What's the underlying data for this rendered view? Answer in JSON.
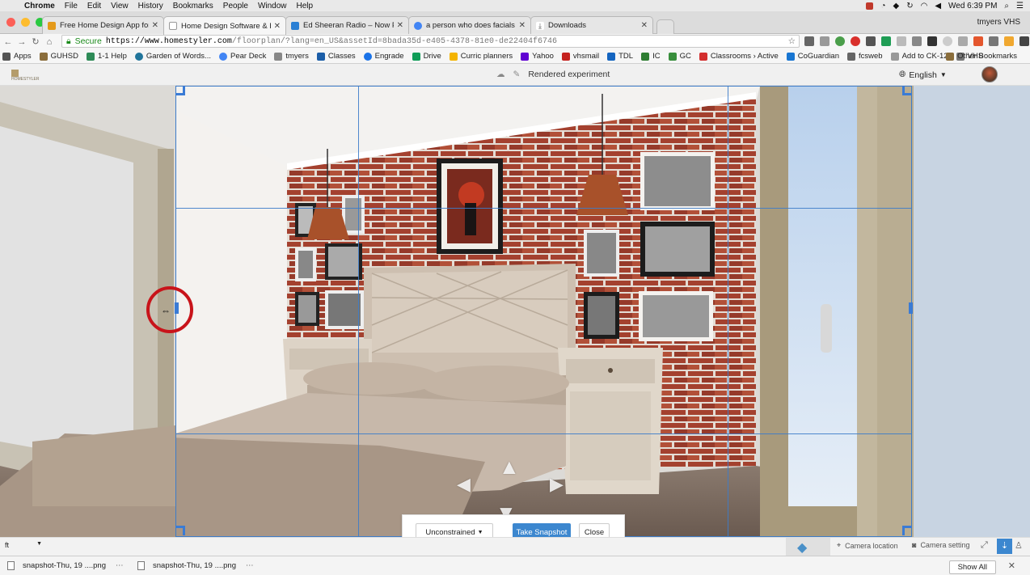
{
  "menubar": {
    "app": "Chrome",
    "items": [
      "File",
      "Edit",
      "View",
      "History",
      "Bookmarks",
      "People",
      "Window",
      "Help"
    ],
    "clock": "Wed 6:39 PM"
  },
  "tabs": [
    {
      "title": "Free Home Design App for In",
      "favicon": "#e49a1a"
    },
    {
      "title": "Home Design Software & FREE",
      "favicon": "#999999"
    },
    {
      "title": "Ed Sheeran Radio – Now Playi",
      "favicon": "#2a7fd4"
    },
    {
      "title": "a person who does facials – G",
      "favicon": "#4285f4"
    },
    {
      "title": "Downloads",
      "favicon": "#555555"
    }
  ],
  "profile": "tmyers VHS",
  "address": {
    "secure": "Secure",
    "host": "https://www.homestyler.com",
    "path": "/floorplan/?lang=en_US&assetId=8bada35d-e405-4378-81e0-de22404f6746"
  },
  "bookmarks": [
    {
      "label": "Apps",
      "color": "#555555"
    },
    {
      "label": "GUHSD",
      "color": "#8a6d3b"
    },
    {
      "label": "1-1 Help",
      "color": "#2e8b57"
    },
    {
      "label": "Garden of Words...",
      "color": "#21759b"
    },
    {
      "label": "Pear Deck",
      "color": "#4285f4"
    },
    {
      "label": "tmyers",
      "color": "#888888"
    },
    {
      "label": "Classes",
      "color": "#1c5ea8"
    },
    {
      "label": "Engrade",
      "color": "#1a73e8"
    },
    {
      "label": "Drive",
      "color": "#0f9d58"
    },
    {
      "label": "Curric planners",
      "color": "#f4b400"
    },
    {
      "label": "Yahoo",
      "color": "#6001d2"
    },
    {
      "label": "vhsmail",
      "color": "#c5221f"
    },
    {
      "label": "TDL",
      "color": "#1565c0"
    },
    {
      "label": "IC",
      "color": "#2e7d32"
    },
    {
      "label": "GC",
      "color": "#388e3c"
    },
    {
      "label": "Classrooms › Active",
      "color": "#d32f2f"
    },
    {
      "label": "CoGuardian",
      "color": "#1976d2"
    },
    {
      "label": "fcsweb",
      "color": "#666666"
    },
    {
      "label": "Add to CK-12",
      "color": "#999999"
    },
    {
      "label": "VHS",
      "color": "#777777"
    }
  ],
  "bookmarks_other": "Other Bookmarks",
  "app_header": {
    "logo": "HOMESTYLER",
    "render_title": "Rendered experiment",
    "language": "English"
  },
  "snapshot": {
    "ratio": "Unconstrained",
    "take": "Take Snapshot",
    "close": "Close"
  },
  "controls": {
    "unit": "ft",
    "camera_location": "Camera location",
    "camera_setting": "Camera setting"
  },
  "downloads": [
    {
      "name": "snapshot-Thu, 19 ....png"
    },
    {
      "name": "snapshot-Thu, 19 ....png"
    }
  ],
  "show_all": "Show All"
}
